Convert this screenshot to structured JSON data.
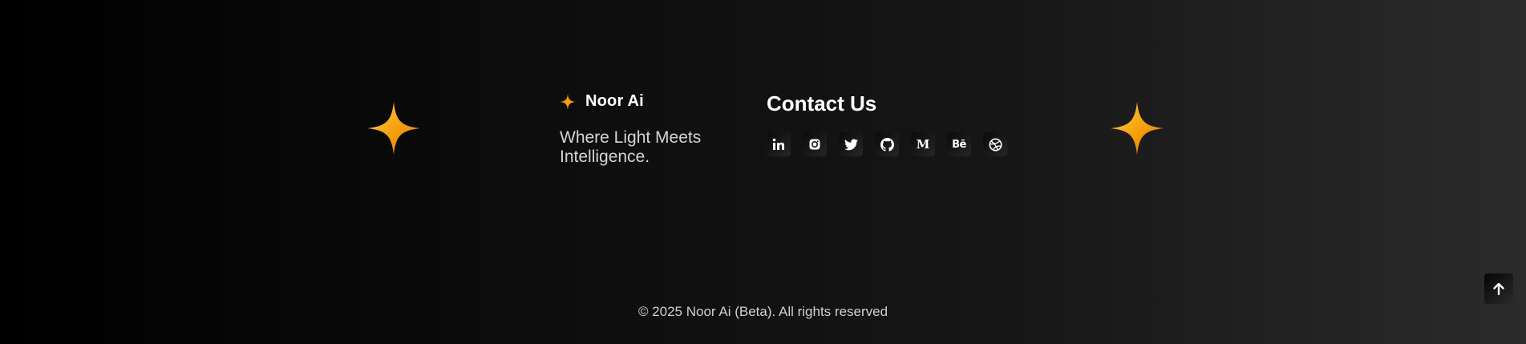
{
  "brand": {
    "name": "Noor Ai",
    "icon": "sparkle-icon",
    "tagline": "Where Light Meets Intelligence."
  },
  "contact": {
    "title": "Contact Us",
    "socials": [
      {
        "name": "linkedin",
        "icon": "linkedin-icon",
        "glyph": "in"
      },
      {
        "name": "instagram",
        "icon": "instagram-icon",
        "glyph": ""
      },
      {
        "name": "twitter",
        "icon": "twitter-icon",
        "glyph": ""
      },
      {
        "name": "github",
        "icon": "github-icon",
        "glyph": ""
      },
      {
        "name": "medium",
        "icon": "medium-icon",
        "glyph": "M"
      },
      {
        "name": "behance",
        "icon": "behance-icon",
        "glyph": "Bē"
      },
      {
        "name": "dribbble",
        "icon": "dribbble-icon",
        "glyph": ""
      }
    ]
  },
  "decorations": {
    "left_icon": "sparkle-icon",
    "right_icon": "sparkle-icon",
    "accent_color": "#f59e0b"
  },
  "footer": {
    "copyright": "© 2025 Noor Ai (Beta). All rights reserved"
  },
  "scroll_top": {
    "icon": "arrow-up-icon"
  }
}
